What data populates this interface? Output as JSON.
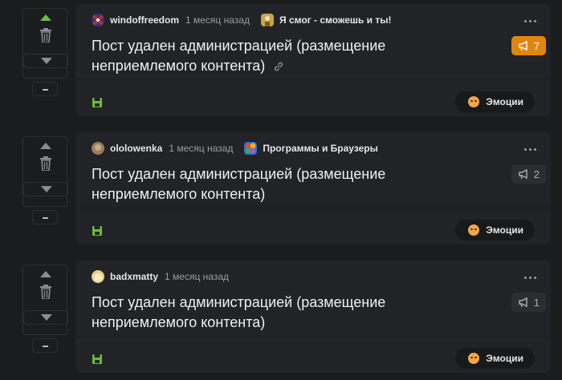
{
  "posts": [
    {
      "author": "windoffreedom",
      "time": "1 месяц назад",
      "community": "Я смог - сможешь и ты!",
      "title": "Пост удален администрацией (размещение неприемлемого контента)",
      "badge_count": "7",
      "badge_style": "hot",
      "vote_active": true,
      "show_link": true,
      "emotions_label": "Эмоции",
      "avatar_color": "#7a2b2b",
      "community_color": "#c9a54a"
    },
    {
      "author": "ololowenka",
      "time": "1 месяц назад",
      "community": "Программы и Браузеры",
      "title": "Пост удален администрацией (размещение неприемлемого контента)",
      "badge_count": "2",
      "badge_style": "cold",
      "vote_active": false,
      "show_link": false,
      "emotions_label": "Эмоции",
      "avatar_color": "#9b7f5a",
      "community_color": "#d7643c"
    },
    {
      "author": "badxmatty",
      "time": "1 месяц назад",
      "community": "",
      "title": "Пост удален администрацией (размещение неприемлемого контента)",
      "badge_count": "1",
      "badge_style": "cold",
      "vote_active": false,
      "show_link": false,
      "emotions_label": "Эмоции",
      "avatar_color": "#e8d18a",
      "community_color": ""
    }
  ]
}
